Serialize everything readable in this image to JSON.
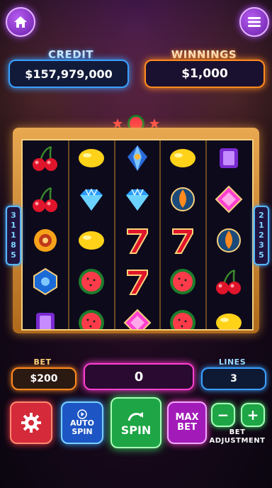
{
  "header": {
    "home_icon": "home-icon",
    "menu_icon": "hamburger-menu-icon"
  },
  "credit": {
    "label": "CREDIT",
    "value": "$157,979,000"
  },
  "winnings": {
    "label": "WINNINGS",
    "value": "$1,000"
  },
  "paylines": {
    "left": "31185",
    "right": "21235"
  },
  "reels": [
    [
      "cherry",
      "lemon",
      "gem",
      "lemon",
      "purple-gem"
    ],
    [
      "cherry",
      "diamond",
      "diamond",
      "orange-gem",
      "pink-gem"
    ],
    [
      "sun-gem",
      "lemon",
      "seven",
      "seven",
      "orange-gem"
    ],
    [
      "blue-gem",
      "watermelon",
      "seven",
      "watermelon",
      "cherry"
    ],
    [
      "purple-gem",
      "watermelon",
      "pink-gem",
      "watermelon",
      "lemon"
    ]
  ],
  "bet": {
    "label": "BET",
    "value": "$200"
  },
  "win_display": {
    "value": "0"
  },
  "lines": {
    "label": "LINES",
    "value": "3"
  },
  "controls": {
    "settings_icon": "gear-icon",
    "auto_spin_label": "AUTO\nSPIN",
    "spin_label": "SPIN",
    "max_bet_label": "MAX\nBET",
    "decrease_label": "−",
    "increase_label": "+",
    "bet_adjust_label": "BET\nADJUSTMENT"
  },
  "colors": {
    "neon_blue": "#3aa0ff",
    "neon_orange": "#ff8a1f",
    "neon_pink": "#ff3fd0",
    "neon_green": "#3fe36a",
    "neon_purple": "#b04cff",
    "gold": "#f6cf7c"
  }
}
